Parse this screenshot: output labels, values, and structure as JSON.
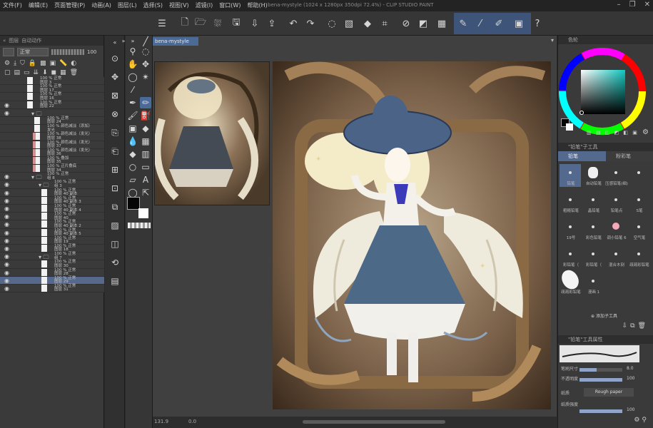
{
  "window": {
    "title": "bena-mystyle (1024 x 1280px 350dpi 72.4%)  - CLIP STUDIO PAINT",
    "menu": [
      "文件(F)",
      "编辑(E)",
      "页面管理(P)",
      "动画(A)",
      "图层(L)",
      "选择(S)",
      "视图(V)",
      "滤镜(I)",
      "窗口(W)",
      "帮助(H)"
    ]
  },
  "toolbar": {
    "icons": [
      "menu-icon",
      "new-icon",
      "open-icon",
      "save-cloud-icon",
      "save-icon",
      "export-icon",
      "export2-icon",
      "undo-icon",
      "redo-icon",
      "loading-icon",
      "clear-icon",
      "fill-icon",
      "transform-icon",
      "snap-off-icon",
      "snap-grid-icon",
      "snap-ruler-icon",
      "pen-stabilize-icon",
      "brush-icon",
      "pencil-icon",
      "record-icon",
      "help-icon"
    ]
  },
  "layer_panel": {
    "tabs": [
      "图层",
      "自动动作"
    ],
    "blend_mode": "正常",
    "opacity": "100",
    "layers": [
      {
        "name": "100 % 正常",
        "sub": "图层 3",
        "visible": false,
        "indent": 0,
        "tag": ""
      },
      {
        "name": "100 % 正常",
        "sub": "图层 17",
        "visible": false,
        "indent": 0,
        "tag": ""
      },
      {
        "name": "100 % 正常",
        "sub": "图层 16",
        "visible": false,
        "indent": 0,
        "tag": ""
      },
      {
        "name": "100 % 正常",
        "sub": "图层 22",
        "visible": true,
        "indent": 0,
        "tag": ""
      },
      {
        "name": "",
        "sub": "",
        "visible": true,
        "indent": 1,
        "tag": "folder"
      },
      {
        "name": "100 % 正常",
        "sub": "图层 24",
        "visible": false,
        "indent": 1,
        "tag": ""
      },
      {
        "name": "100 % 颜色减淡（添加）",
        "sub": "发光",
        "visible": false,
        "indent": 1,
        "tag": ""
      },
      {
        "name": "100 % 颜色减淡（发光）",
        "sub": "图层 38",
        "visible": false,
        "indent": 1,
        "tag": "red"
      },
      {
        "name": "100 % 颜色减淡（发光）",
        "sub": "图层 37",
        "visible": false,
        "indent": 1,
        "tag": "red"
      },
      {
        "name": "100 % 颜色减淡（发光）",
        "sub": "图层 36",
        "visible": false,
        "indent": 1,
        "tag": "red"
      },
      {
        "name": "100 % 叠加",
        "sub": "图层 35",
        "visible": false,
        "indent": 1,
        "tag": "red"
      },
      {
        "name": "100 % 正片叠底",
        "sub": "图层 34",
        "visible": false,
        "indent": 1,
        "tag": "red"
      },
      {
        "name": "100 % 正常",
        "sub": "组 8",
        "visible": true,
        "indent": 1,
        "tag": "folder"
      },
      {
        "name": "100 % 正常",
        "sub": "组 3",
        "visible": true,
        "indent": 2,
        "tag": "folder"
      },
      {
        "name": "100 % 正常",
        "sub": "图层 40 副本",
        "visible": true,
        "indent": 2,
        "tag": ""
      },
      {
        "name": "100 % 正常",
        "sub": "图层 40 副本 3",
        "visible": true,
        "indent": 2,
        "tag": ""
      },
      {
        "name": "100 % 正常",
        "sub": "图层 40 副本 4",
        "visible": true,
        "indent": 2,
        "tag": ""
      },
      {
        "name": "100 % 正常",
        "sub": "图层 40",
        "visible": true,
        "indent": 2,
        "tag": ""
      },
      {
        "name": "100 % 正常",
        "sub": "图层 40 副本 2",
        "visible": true,
        "indent": 2,
        "tag": ""
      },
      {
        "name": "100 % 正常",
        "sub": "图层 40 副本 5",
        "visible": true,
        "indent": 2,
        "tag": ""
      },
      {
        "name": "100 % 正常",
        "sub": "图层 19",
        "visible": true,
        "indent": 2,
        "tag": ""
      },
      {
        "name": "100 % 正常",
        "sub": "图层 18",
        "visible": true,
        "indent": 2,
        "tag": ""
      },
      {
        "name": "100 % 正常",
        "sub": "组 7",
        "visible": true,
        "indent": 2,
        "tag": "folder"
      },
      {
        "name": "100 % 正常",
        "sub": "图层 30",
        "visible": true,
        "indent": 2,
        "tag": ""
      },
      {
        "name": "100 % 正常",
        "sub": "图层 28",
        "visible": true,
        "indent": 2,
        "tag": ""
      },
      {
        "name": "100 % 正常",
        "sub": "图层 29",
        "visible": true,
        "indent": 2,
        "tag": "selected"
      },
      {
        "name": "100 % 正常",
        "sub": "图层 31",
        "visible": true,
        "indent": 2,
        "tag": ""
      }
    ]
  },
  "canvas": {
    "doc_tab": "bena-mystyle",
    "status_zoom": "131.9",
    "status_angle": "0.0"
  },
  "color": {
    "head": "色轮",
    "foreground": "#060606",
    "background": "#ffffff"
  },
  "sub_tool": {
    "head": "\"铅笔\"子工具",
    "tabs": [
      "铅笔",
      "粉彩笔"
    ],
    "brushes": [
      "铅笔",
      "自动铅笔",
      "压感铅笔(细)",
      "",
      "粗糙铅笔",
      "晶铅笔",
      "铅笔点",
      "S笔",
      "19号",
      "彩色铅笔",
      "调小铅笔 6",
      "空气笔",
      "彩铅笔（",
      "彩铅笔（",
      "混合木刻",
      "疏疏彩铅笔",
      "疏疏彩铅笔",
      "漫画 1"
    ],
    "add_label": "添加子工具"
  },
  "tool_property": {
    "head": "\"铅笔\"工具属性",
    "rows": [
      {
        "label": "笔刷尺寸",
        "value": "8.0"
      },
      {
        "label": "不透明度",
        "value": "100"
      },
      {
        "label": "纸质",
        "value": "Rough paper"
      },
      {
        "label": "纸质强度",
        "value": "100"
      }
    ]
  }
}
